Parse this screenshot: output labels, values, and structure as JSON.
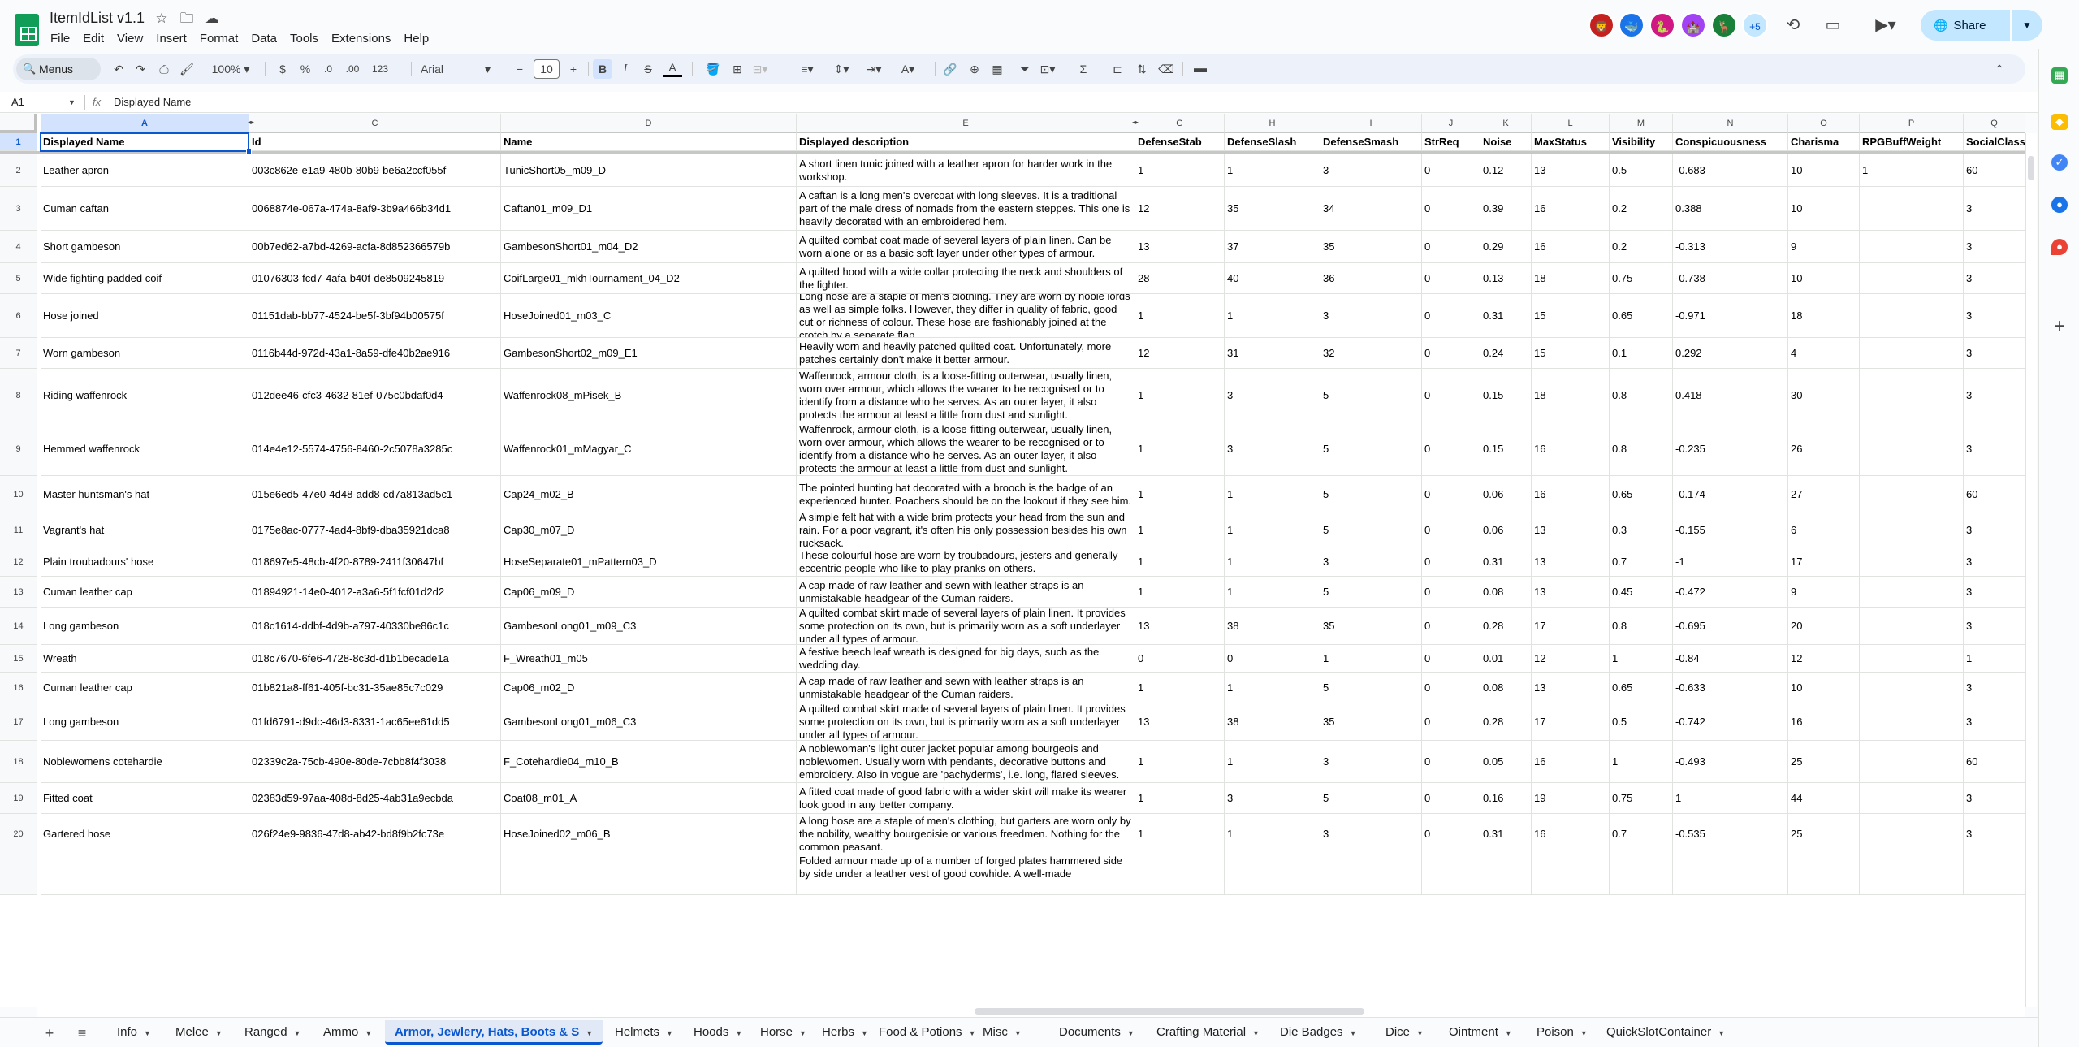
{
  "doc": {
    "title": "ItemIdList v1.1"
  },
  "menus": [
    "File",
    "Edit",
    "View",
    "Insert",
    "Format",
    "Data",
    "Tools",
    "Extensions",
    "Help"
  ],
  "header": {
    "avatars": [
      {
        "color": "#c5221f",
        "glyph": "🦁"
      },
      {
        "color": "#1a73e8",
        "glyph": "🐳"
      },
      {
        "color": "#d01884",
        "glyph": "🐍"
      },
      {
        "color": "#a142f4",
        "glyph": "🏰"
      },
      {
        "color": "#188038",
        "glyph": "🦌"
      }
    ],
    "more_avatars": "+5",
    "share_label": "Share"
  },
  "toolbar": {
    "menus_label": "Menus",
    "zoom": "100%",
    "currency": "$",
    "percent": "%",
    "dec_less": ".0",
    "dec_more": ".00",
    "format_123": "123",
    "font": "Arial",
    "font_size": "10"
  },
  "formula_bar": {
    "cell_ref": "A1",
    "content": "Displayed Name"
  },
  "grid": {
    "columns": [
      {
        "letter": "A",
        "selected": true
      },
      {
        "letter": "C"
      },
      {
        "letter": "D"
      },
      {
        "letter": "E"
      },
      {
        "letter": "G"
      },
      {
        "letter": "H"
      },
      {
        "letter": "I"
      },
      {
        "letter": "J"
      },
      {
        "letter": "K"
      },
      {
        "letter": "L"
      },
      {
        "letter": "M"
      },
      {
        "letter": "N"
      },
      {
        "letter": "O"
      },
      {
        "letter": "P"
      },
      {
        "letter": "Q"
      }
    ],
    "header_row": [
      "Displayed Name",
      "Id",
      "Name",
      "Displayed description",
      "DefenseStab",
      "DefenseSlash",
      "DefenseSmash",
      "StrReq",
      "Noise",
      "MaxStatus",
      "Visibility",
      "Conspicuousness",
      "Charisma",
      "RPGBuffWeight",
      "SocialClass"
    ],
    "rows": [
      {
        "num": "2",
        "cells": [
          "Leather apron",
          "003c862e-e1a9-480b-80b9-be6a2ccf055f",
          "TunicShort05_m09_D",
          "A short linen tunic joined with a leather apron for harder work in the workshop.",
          "1",
          "1",
          "3",
          "0",
          "0.12",
          "13",
          "0.5",
          "-0.683",
          "10",
          "1",
          "60"
        ]
      },
      {
        "num": "3",
        "cells": [
          "Cuman caftan",
          "0068874e-067a-474a-8af9-3b9a466b34d1",
          "Caftan01_m09_D1",
          "A caftan is a long men's overcoat with long sleeves. It is a traditional part of the male dress of nomads from the eastern steppes. This one is heavily decorated with an embroidered hem.",
          "12",
          "35",
          "34",
          "0",
          "0.39",
          "16",
          "0.2",
          "0.388",
          "10",
          "",
          "3"
        ]
      },
      {
        "num": "4",
        "cells": [
          "Short gambeson",
          "00b7ed62-a7bd-4269-acfa-8d852366579b",
          "GambesonShort01_m04_D2",
          "A quilted combat coat made of several layers of plain linen. Can be worn alone or as a basic soft layer under other types of armour.",
          "13",
          "37",
          "35",
          "0",
          "0.29",
          "16",
          "0.2",
          "-0.313",
          "9",
          "",
          "3"
        ]
      },
      {
        "num": "5",
        "cells": [
          "Wide fighting padded coif",
          "01076303-fcd7-4afa-b40f-de8509245819",
          "CoifLarge01_mkhTournament_04_D2",
          "A quilted hood with a wide collar protecting the neck and shoulders of the fighter.",
          "28",
          "40",
          "36",
          "0",
          "0.13",
          "18",
          "0.75",
          "-0.738",
          "10",
          "",
          "3"
        ]
      },
      {
        "num": "6",
        "cells": [
          "Hose joined",
          "01151dab-bb77-4524-be5f-3bf94b00575f",
          "HoseJoined01_m03_C",
          "Long hose are a staple of men's clothing. They are worn by noble lords as well as simple folks. However, they differ in quality of fabric, good cut or richness of colour. These hose are fashionably joined at the crotch by a separate flap.",
          "1",
          "1",
          "3",
          "0",
          "0.31",
          "15",
          "0.65",
          "-0.971",
          "18",
          "",
          "3"
        ]
      },
      {
        "num": "7",
        "cells": [
          "Worn gambeson",
          "0116b44d-972d-43a1-8a59-dfe40b2ae916",
          "GambesonShort02_m09_E1",
          "Heavily worn and heavily patched quilted coat. Unfortunately, more patches certainly don't make it better armour.",
          "12",
          "31",
          "32",
          "0",
          "0.24",
          "15",
          "0.1",
          "0.292",
          "4",
          "",
          "3"
        ]
      },
      {
        "num": "8",
        "cells": [
          "Riding waffenrock",
          "012dee46-cfc3-4632-81ef-075c0bdaf0d4",
          "Waffenrock08_mPisek_B",
          "Waffenrock, armour cloth, is a loose-fitting outerwear, usually linen, worn over armour, which allows the wearer to be recognised or to identify from a distance who he serves. As an outer layer, it also protects the armour at least a little from dust and sunlight.",
          "1",
          "3",
          "5",
          "0",
          "0.15",
          "18",
          "0.8",
          "0.418",
          "30",
          "",
          "3"
        ]
      },
      {
        "num": "9",
        "cells": [
          "Hemmed waffenrock",
          "014e4e12-5574-4756-8460-2c5078a3285c",
          "Waffenrock01_mMagyar_C",
          "Waffenrock, armour cloth, is a loose-fitting outerwear, usually linen, worn over armour, which allows the wearer to be recognised or to identify from a distance who he serves. As an outer layer, it also protects the armour at least a little from dust and sunlight.",
          "1",
          "3",
          "5",
          "0",
          "0.15",
          "16",
          "0.8",
          "-0.235",
          "26",
          "",
          "3"
        ]
      },
      {
        "num": "10",
        "cells": [
          "Master huntsman's hat",
          "015e6ed5-47e0-4d48-add8-cd7a813ad5c1",
          "Cap24_m02_B",
          "The pointed hunting hat decorated with a brooch is the badge of an experienced hunter. Poachers should be on the lookout if they see him.",
          "1",
          "1",
          "5",
          "0",
          "0.06",
          "16",
          "0.65",
          "-0.174",
          "27",
          "",
          "60"
        ]
      },
      {
        "num": "11",
        "cells": [
          "Vagrant's hat",
          "0175e8ac-0777-4ad4-8bf9-dba35921dca8",
          "Cap30_m07_D",
          "A simple felt hat with a wide brim protects your head from the sun and rain. For a poor vagrant, it's often his only possession besides his own rucksack.",
          "1",
          "1",
          "5",
          "0",
          "0.06",
          "13",
          "0.3",
          "-0.155",
          "6",
          "",
          "3"
        ]
      },
      {
        "num": "12",
        "cells": [
          "Plain troubadours' hose",
          "018697e5-48cb-4f20-8789-2411f30647bf",
          "HoseSeparate01_mPattern03_D",
          "These colourful hose are worn by troubadours, jesters and generally eccentric people who like to play pranks on others.",
          "1",
          "1",
          "3",
          "0",
          "0.31",
          "13",
          "0.7",
          "-1",
          "17",
          "",
          "3"
        ]
      },
      {
        "num": "13",
        "cells": [
          "Cuman leather cap",
          "01894921-14e0-4012-a3a6-5f1fcf01d2d2",
          "Cap06_m09_D",
          "A cap made of raw leather and sewn with leather straps is an unmistakable headgear of the Cuman raiders.",
          "1",
          "1",
          "5",
          "0",
          "0.08",
          "13",
          "0.45",
          "-0.472",
          "9",
          "",
          "3"
        ]
      },
      {
        "num": "14",
        "cells": [
          "Long gambeson",
          "018c1614-ddbf-4d9b-a797-40330be86c1c",
          "GambesonLong01_m09_C3",
          "A quilted combat skirt made of several layers of plain linen. It provides some protection on its own, but is primarily worn as a soft underlayer under all types of armour.",
          "13",
          "38",
          "35",
          "0",
          "0.28",
          "17",
          "0.8",
          "-0.695",
          "20",
          "",
          "3"
        ]
      },
      {
        "num": "15",
        "cells": [
          "Wreath",
          "018c7670-6fe6-4728-8c3d-d1b1becade1a",
          "F_Wreath01_m05",
          "A festive beech leaf wreath is designed for big days, such as the wedding day.",
          "0",
          "0",
          "1",
          "0",
          "0.01",
          "12",
          "1",
          "-0.84",
          "12",
          "",
          "1"
        ]
      },
      {
        "num": "16",
        "cells": [
          "Cuman leather cap",
          "01b821a8-ff61-405f-bc31-35ae85c7c029",
          "Cap06_m02_D",
          "A cap made of raw leather and sewn with leather straps is an unmistakable headgear of the Cuman raiders.",
          "1",
          "1",
          "5",
          "0",
          "0.08",
          "13",
          "0.65",
          "-0.633",
          "10",
          "",
          "3"
        ]
      },
      {
        "num": "17",
        "cells": [
          "Long gambeson",
          "01fd6791-d9dc-46d3-8331-1ac65ee61dd5",
          "GambesonLong01_m06_C3",
          "A quilted combat skirt made of several layers of plain linen. It provides some protection on its own, but is primarily worn as a soft underlayer under all types of armour.",
          "13",
          "38",
          "35",
          "0",
          "0.28",
          "17",
          "0.5",
          "-0.742",
          "16",
          "",
          "3"
        ]
      },
      {
        "num": "18",
        "cells": [
          "Noblewomens cotehardie",
          "02339c2a-75cb-490e-80de-7cbb8f4f3038",
          "F_Cotehardie04_m10_B",
          "A noblewoman's light outer jacket popular among bourgeois and noblewomen. Usually worn with pendants, decorative buttons and embroidery. Also in vogue are 'pachyderms', i.e. long, flared sleeves.",
          "1",
          "1",
          "3",
          "0",
          "0.05",
          "16",
          "1",
          "-0.493",
          "25",
          "",
          "60"
        ]
      },
      {
        "num": "19",
        "cells": [
          "Fitted coat",
          "02383d59-97aa-408d-8d25-4ab31a9ecbda",
          "Coat08_m01_A",
          "A fitted coat made of good fabric with a wider skirt will make its wearer look good in any better company.",
          "1",
          "3",
          "5",
          "0",
          "0.16",
          "19",
          "0.75",
          "1",
          "44",
          "",
          "3"
        ]
      },
      {
        "num": "20",
        "cells": [
          "Gartered hose",
          "026f24e9-9836-47d8-ab42-bd8f9b2fc73e",
          "HoseJoined02_m06_B",
          "A long hose are a staple of men's clothing, but garters are worn only by the nobility, wealthy bourgeoisie or various freedmen. Nothing for the common peasant.",
          "1",
          "1",
          "3",
          "0",
          "0.31",
          "16",
          "0.7",
          "-0.535",
          "25",
          "",
          "3"
        ]
      },
      {
        "num": "",
        "cells": [
          "",
          "",
          "",
          "Folded armour made up of a number of forged plates hammered side by side under a leather vest of good cowhide. A well-made",
          "",
          "",
          "",
          "",
          "",
          "",
          "",
          "",
          "",
          "",
          ""
        ]
      }
    ]
  },
  "sheets": [
    {
      "name": "Info"
    },
    {
      "name": "Melee"
    },
    {
      "name": "Ranged"
    },
    {
      "name": "Ammo"
    },
    {
      "name": "Armor, Jewlery, Hats, Boots & S",
      "active": true
    },
    {
      "name": "Helmets"
    },
    {
      "name": "Hoods"
    },
    {
      "name": "Horse"
    },
    {
      "name": "Herbs"
    },
    {
      "name": "Food & Potions"
    },
    {
      "name": "Misc"
    },
    {
      "name": "Documents"
    },
    {
      "name": "Crafting Material"
    },
    {
      "name": "Die Badges"
    },
    {
      "name": "Dice"
    },
    {
      "name": "Ointment"
    },
    {
      "name": "Poison"
    },
    {
      "name": "QuickSlotContainer"
    }
  ],
  "colors": {
    "accent": "#0b57d0",
    "share_bg": "#c2e7ff",
    "sheets_green": "#0f9d58"
  },
  "icons": {
    "star": "star-icon",
    "move": "folder-icon",
    "cloud": "cloud-icon",
    "history": "history-icon",
    "comments": "comment-icon",
    "meet": "video-icon"
  }
}
